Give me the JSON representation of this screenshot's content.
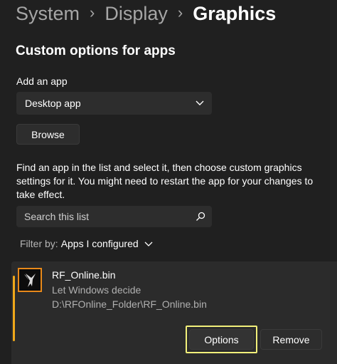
{
  "breadcrumb": {
    "items": [
      "System",
      "Display",
      "Graphics"
    ]
  },
  "section_title": "Custom options for apps",
  "add_app": {
    "label": "Add an app",
    "dropdown_value": "Desktop app",
    "browse_label": "Browse"
  },
  "description": "Find an app in the list and select it, then choose custom graphics settings for it. You might need to restart the app for your changes to take effect.",
  "search": {
    "placeholder": "Search this list"
  },
  "filter": {
    "label": "Filter by:",
    "value": "Apps I configured"
  },
  "app_entry": {
    "name": "RF_Online.bin",
    "preference": "Let Windows decide",
    "path": "D:\\RFOnline_Folder\\RF_Online.bin",
    "options_label": "Options",
    "remove_label": "Remove"
  },
  "colors": {
    "background": "#202020",
    "card": "#2b2b2b",
    "accent_bar": "#f0a81a",
    "highlight": "#f2f07a"
  }
}
